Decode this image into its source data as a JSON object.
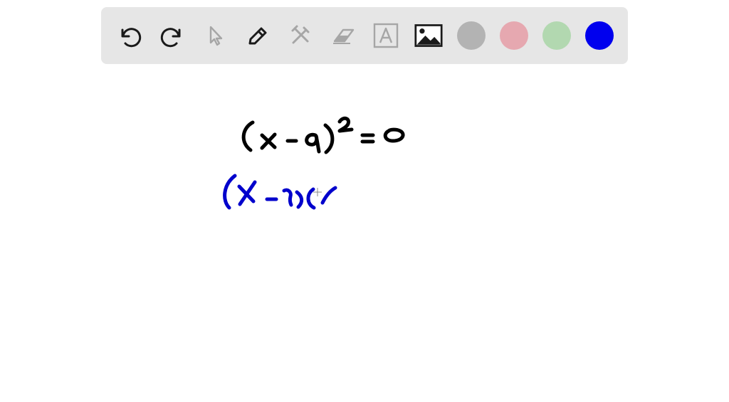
{
  "toolbar": {
    "tools": [
      {
        "name": "undo-icon",
        "enabled": true
      },
      {
        "name": "redo-icon",
        "enabled": true
      },
      {
        "name": "select-pointer-icon",
        "enabled": false
      },
      {
        "name": "pen-icon",
        "enabled": true
      },
      {
        "name": "tools-icon",
        "enabled": false
      },
      {
        "name": "eraser-icon",
        "enabled": false
      },
      {
        "name": "text-icon",
        "enabled": false
      },
      {
        "name": "image-icon",
        "enabled": true
      }
    ],
    "colors": [
      {
        "name": "gray",
        "hex": "#b3b3b3"
      },
      {
        "name": "pink",
        "hex": "#e6a8b0"
      },
      {
        "name": "green",
        "hex": "#b2d8b0"
      },
      {
        "name": "blue",
        "hex": "#0000ee"
      }
    ],
    "selected_color": "blue"
  },
  "canvas": {
    "ink_colors": {
      "line1": "#000000",
      "line2": "#0000cc"
    }
  }
}
